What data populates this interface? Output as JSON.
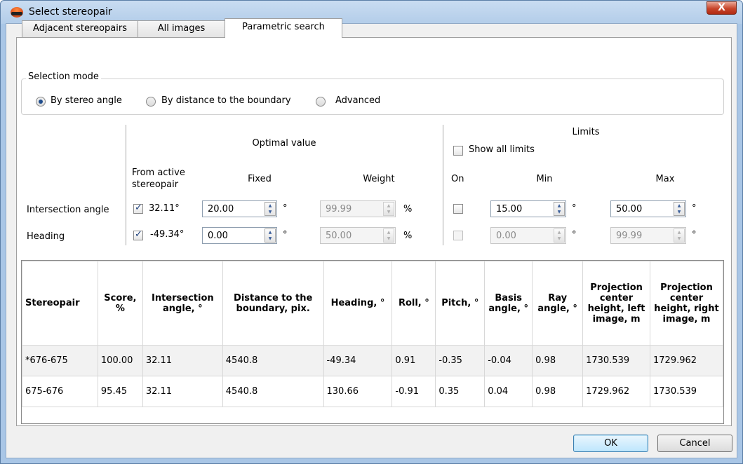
{
  "window": {
    "title": "Select stereopair",
    "close_label": "X"
  },
  "tabs": [
    {
      "label": "Adjacent stereopairs"
    },
    {
      "label": "All images"
    },
    {
      "label": "Parametric search"
    }
  ],
  "selection_mode": {
    "title": "Selection mode",
    "options": [
      {
        "label": "By stereo angle",
        "checked": true
      },
      {
        "label": "By distance to the boundary",
        "checked": false
      },
      {
        "label": "Advanced",
        "checked": false
      }
    ]
  },
  "params": {
    "optimal_title": "Optimal value",
    "limits_title": "Limits",
    "show_all_limits": "Show all limits",
    "col_from_active": "From active stereopair",
    "col_fixed": "Fixed",
    "col_weight": "Weight",
    "col_on": "On",
    "col_min": "Min",
    "col_max": "Max",
    "degree_unit": "°",
    "percent_unit": "%",
    "rows": [
      {
        "label": "Intersection angle",
        "active_value": "32.11°",
        "active_checked": true,
        "fixed": "20.00",
        "weight": "99.99",
        "on_checked": false,
        "min": "15.00",
        "max": "50.00"
      },
      {
        "label": "Heading",
        "active_value": "-49.34°",
        "active_checked": true,
        "fixed": "0.00",
        "weight": "50.00",
        "on_checked": false,
        "min": "0.00",
        "max": "99.99"
      }
    ]
  },
  "results": {
    "headers": [
      "Stereopair",
      "Score, %",
      "Intersection angle, °",
      "Distance to the boundary, pix.",
      "Heading, °",
      "Roll, °",
      "Pitch, °",
      "Basis angle, °",
      "Ray angle, °",
      "Projection center height, left image, m",
      "Projection center height, right image, m"
    ],
    "rows": [
      [
        "*676-675",
        "100.00",
        "32.11",
        "4540.8",
        "-49.34",
        "0.91",
        "-0.35",
        "-0.04",
        "0.98",
        "1730.539",
        "1729.962"
      ],
      [
        "675-676",
        "95.45",
        "32.11",
        "4540.8",
        "130.66",
        "-0.91",
        "0.35",
        "0.04",
        "0.98",
        "1729.962",
        "1730.539"
      ]
    ]
  },
  "buttons": {
    "ok": "OK",
    "cancel": "Cancel"
  }
}
